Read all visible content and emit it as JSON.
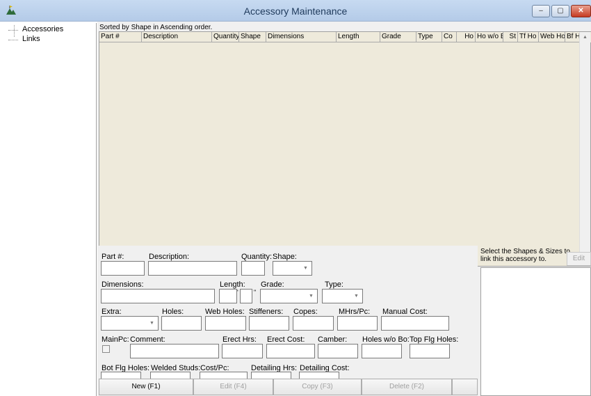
{
  "window": {
    "title": "Accessory Maintenance",
    "minimize_glyph": "‒",
    "maximize_glyph": "▢",
    "close_glyph": "✕"
  },
  "tree": {
    "items": [
      {
        "label": "Accessories"
      },
      {
        "label": "Links"
      }
    ]
  },
  "grid": {
    "sort_label": "Sorted by Shape in Ascending order.",
    "columns": [
      "Part #",
      "Description",
      "Quantity",
      "Shape",
      "Dimensions",
      "Length",
      "Grade",
      "Type",
      "Co",
      "Ho",
      "Ho w/o Bo",
      "St",
      "Tf Ho",
      "Web Ho",
      "Bf Ho"
    ],
    "rows": []
  },
  "form": {
    "part_label": "Part #:",
    "description_label": "Description:",
    "quantity_label": "Quantity:",
    "shape_label": "Shape:",
    "dimensions_label": "Dimensions:",
    "length_label": "Length:",
    "length_feet_mark": "'",
    "length_inch_mark": "\"",
    "grade_label": "Grade:",
    "type_label": "Type:",
    "extra_label": "Extra:",
    "holes_label": "Holes:",
    "web_holes_label": "Web Holes:",
    "stiffeners_label": "Stiffeners:",
    "copes_label": "Copes:",
    "mhrs_label": "MHrs/Pc:",
    "manual_cost_label": "Manual Cost:",
    "mainpc_label": "MainPc:",
    "comment_label": "Comment:",
    "erect_hrs_label": "Erect Hrs:",
    "erect_cost_label": "Erect Cost:",
    "camber_label": "Camber:",
    "holes_wo_bo_label": "Holes w/o Bo:",
    "top_flg_holes_label": "Top Flg Holes:",
    "bot_flg_holes_label": "Bot Flg Holes:",
    "welded_studs_label": "Welded Studs:",
    "cost_pc_label": "Cost/Pc:",
    "detailing_hrs_label": "Detailing Hrs:",
    "detailing_cost_label": "Detailing Cost:"
  },
  "right_panel": {
    "instruction": "Select the Shapes & Sizes to link this accessory to.",
    "edit_label": "Edit"
  },
  "buttons": {
    "new_label": "New (F1)",
    "edit_label": "Edit (F4)",
    "copy_label": "Copy (F3)",
    "delete_label": "Delete (F2)"
  },
  "icons": {
    "app_icon": "mountain-flag-icon",
    "dropdown_arrow": "▼",
    "scroll_up": "▲",
    "scroll_down": "▼"
  },
  "colors": {
    "titlebar": "#c7daf1",
    "grid_background": "#eeeadb",
    "close_button": "#c63a22"
  }
}
